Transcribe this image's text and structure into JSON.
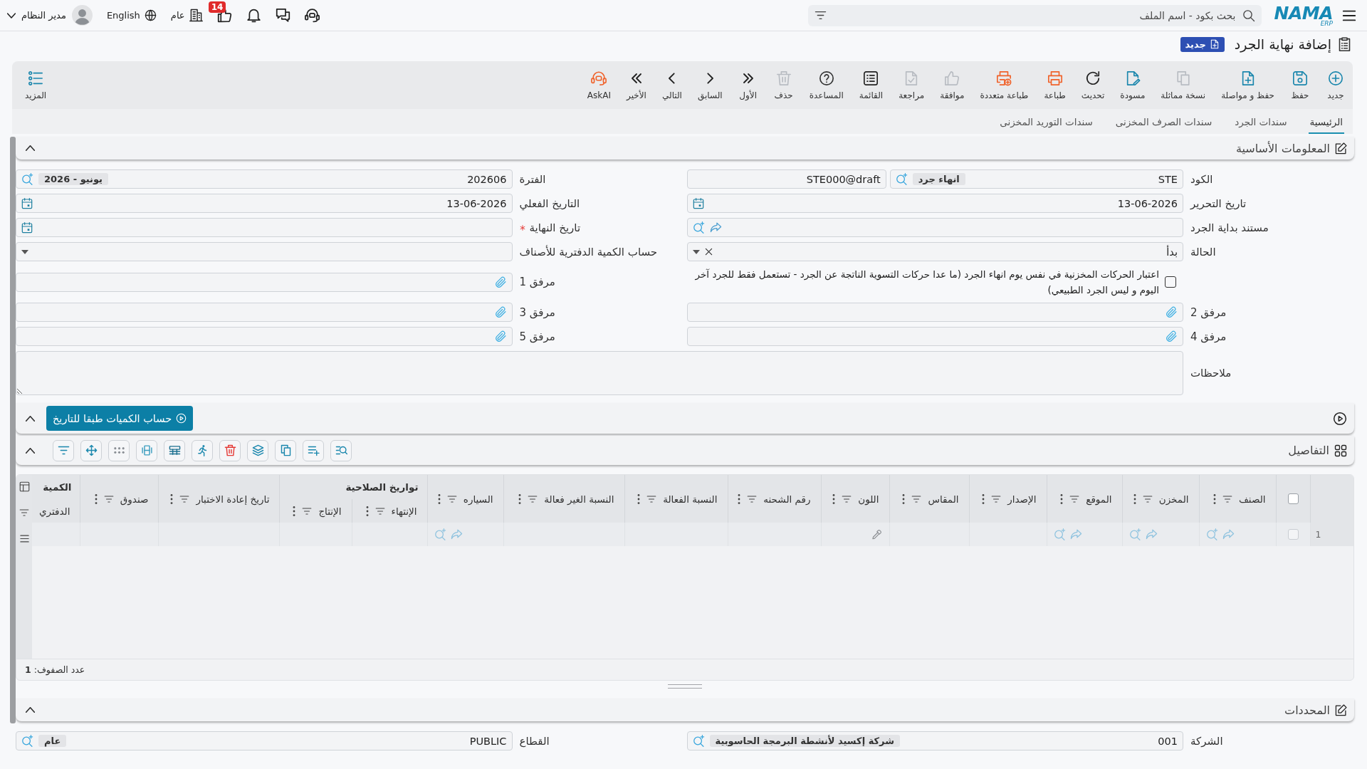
{
  "top_bar": {
    "logo": "NAMA",
    "logo_tagline": "ERP",
    "search": {
      "placeholder": "بحث بكود - اسم الملف"
    },
    "notifications_badge": "14",
    "company": "عام",
    "language": "English",
    "user": "مدير النظام"
  },
  "page": {
    "title": "إضافة نهاية الجرد",
    "status": "جديد"
  },
  "toolbar": {
    "buttons": [
      {
        "label": "جديد",
        "disabled": false
      },
      {
        "label": "حفظ",
        "disabled": false
      },
      {
        "label": "حفظ و مواصلة",
        "disabled": false
      },
      {
        "label": "نسخة مماثلة",
        "disabled": true
      },
      {
        "label": "مسودة",
        "disabled": false
      },
      {
        "label": "تحديث",
        "disabled": false
      },
      {
        "label": "طباعة",
        "disabled": false
      },
      {
        "label": "طباعة متعددة",
        "disabled": false
      },
      {
        "label": "موافقة",
        "disabled": true
      },
      {
        "label": "مراجعة",
        "disabled": true
      },
      {
        "label": "القائمة",
        "disabled": false
      },
      {
        "label": "المساعدة",
        "disabled": false
      },
      {
        "label": "حذف",
        "disabled": true
      },
      {
        "label": "الأول",
        "disabled": false
      },
      {
        "label": "السابق",
        "disabled": false
      },
      {
        "label": "التالي",
        "disabled": false
      },
      {
        "label": "الأخير",
        "disabled": false
      },
      {
        "label": "AskAI",
        "disabled": false
      }
    ],
    "more": "المزيد"
  },
  "tabs": [
    {
      "label": "الرئيسية",
      "selected": true
    },
    {
      "label": "سندات الجرد",
      "selected": false
    },
    {
      "label": "سندات الصرف المخزنى",
      "selected": false
    },
    {
      "label": "سندات التوريد المخزنى",
      "selected": false
    }
  ],
  "basic_info": {
    "title": "المعلومات الأساسية",
    "expanded": true,
    "fields": [
      {
        "kind": "code",
        "label": "الكود",
        "value": "STE",
        "tag": "انهاء جرد",
        "serial": "STE000@draft",
        "required": false
      },
      {
        "kind": "lookup",
        "label": "الفترة",
        "value": "202606",
        "tag": "يونيو - 2026",
        "required": false
      },
      {
        "kind": "date",
        "label": "تاريخ التحرير",
        "value": "13-06-2026",
        "required": false
      },
      {
        "kind": "date",
        "label": "التاريخ الفعلي",
        "value": "13-06-2026",
        "required": false
      },
      {
        "kind": "reference",
        "label": "مستند بداية الجرد",
        "required": false
      },
      {
        "kind": "date",
        "label": "تاريخ النهاية",
        "required": true
      },
      {
        "kind": "select",
        "label": "الحالة",
        "value": "بدأ",
        "required": false
      },
      {
        "kind": "select",
        "label": "حساب الكمية الدفترية للأصناف",
        "required": false
      },
      {
        "kind": "checkbox",
        "text": "اعتبار الحركات المخزنية في نفس يوم انهاء الجرد (ما عدا حركات التسوية الناتجة عن الجرد - تستعمل فقط للجرد آخر اليوم و ليس الجرد الطبيعي)",
        "checked": false,
        "required": false
      },
      {
        "kind": "attachment",
        "label": "مرفق 1",
        "required": false
      },
      {
        "kind": "attachment",
        "label": "مرفق 2",
        "required": false
      },
      {
        "kind": "attachment",
        "label": "مرفق 3",
        "required": false
      },
      {
        "kind": "attachment",
        "label": "مرفق 4",
        "required": false
      },
      {
        "kind": "attachment",
        "label": "مرفق 5",
        "required": false
      },
      {
        "kind": "textarea",
        "label": "ملاحظات",
        "required": false
      }
    ]
  },
  "calculation": {
    "button": "حساب الكميات طبقا للتاريخ",
    "expanded": true
  },
  "details": {
    "title": "التفاصيل",
    "expanded": true,
    "select_all": {
      "checked": false
    },
    "columns": [
      {
        "label": "الصنف",
        "kind": "lookup"
      },
      {
        "label": "المخزن",
        "kind": "lookup"
      },
      {
        "label": "الموقع",
        "kind": "lookup"
      },
      {
        "label": "الإصدار",
        "kind": "text"
      },
      {
        "label": "المقاس",
        "kind": "text"
      },
      {
        "label": "اللون",
        "kind": "color"
      },
      {
        "label": "رقم الشحنه",
        "kind": "text"
      },
      {
        "label": "النسبة الفعالة",
        "kind": "text"
      },
      {
        "label": "النسبة الغير فعالة",
        "kind": "text"
      },
      {
        "label": "السياره",
        "kind": "lookup"
      },
      {
        "label": "تواريخ الصلاحية",
        "kind": "group",
        "children": [
          {
            "label": "الإنتهاء",
            "kind": "text"
          },
          {
            "label": "الإنتاج",
            "kind": "text"
          }
        ]
      },
      {
        "label": "تاريخ إعادة الاختبار",
        "kind": "text"
      },
      {
        "label": "صندوق",
        "kind": "text"
      },
      {
        "label": "الكمية",
        "kind": "group",
        "children": [
          {
            "label": "الدفتري",
            "kind": "plain"
          }
        ]
      }
    ],
    "rows": [
      {
        "number": "1",
        "selected": false
      }
    ],
    "row_count": "عدد الصفوف: **1**"
  },
  "parameters": {
    "title": "المحددات",
    "expanded": true,
    "fields": [
      {
        "kind": "lookup",
        "label": "الشركة",
        "value": "001",
        "tag": "شركة إكسيد لأنشطة البرمجة الحاسوبية",
        "required": false
      },
      {
        "kind": "lookup",
        "label": "القطاع",
        "value": "PUBLIC",
        "tag": "عام",
        "required": false
      }
    ]
  }
}
